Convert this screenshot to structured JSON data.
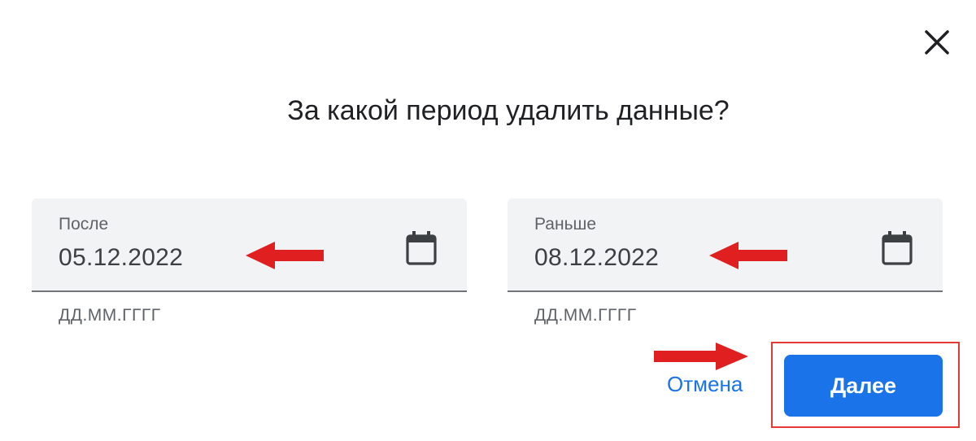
{
  "dialog": {
    "title": "За какой период удалить данные?",
    "close_icon": "close-icon"
  },
  "fields": {
    "after": {
      "label": "После",
      "value": "05.12.2022",
      "hint": "ДД.ММ.ГГГГ",
      "icon": "calendar-icon"
    },
    "before": {
      "label": "Раньше",
      "value": "08.12.2022",
      "hint": "ДД.ММ.ГГГГ",
      "icon": "calendar-icon"
    }
  },
  "actions": {
    "cancel_label": "Отмена",
    "next_label": "Далее"
  },
  "colors": {
    "accent": "#1a73e8",
    "annotation": "#e02020",
    "field_background": "#f1f3f4"
  }
}
